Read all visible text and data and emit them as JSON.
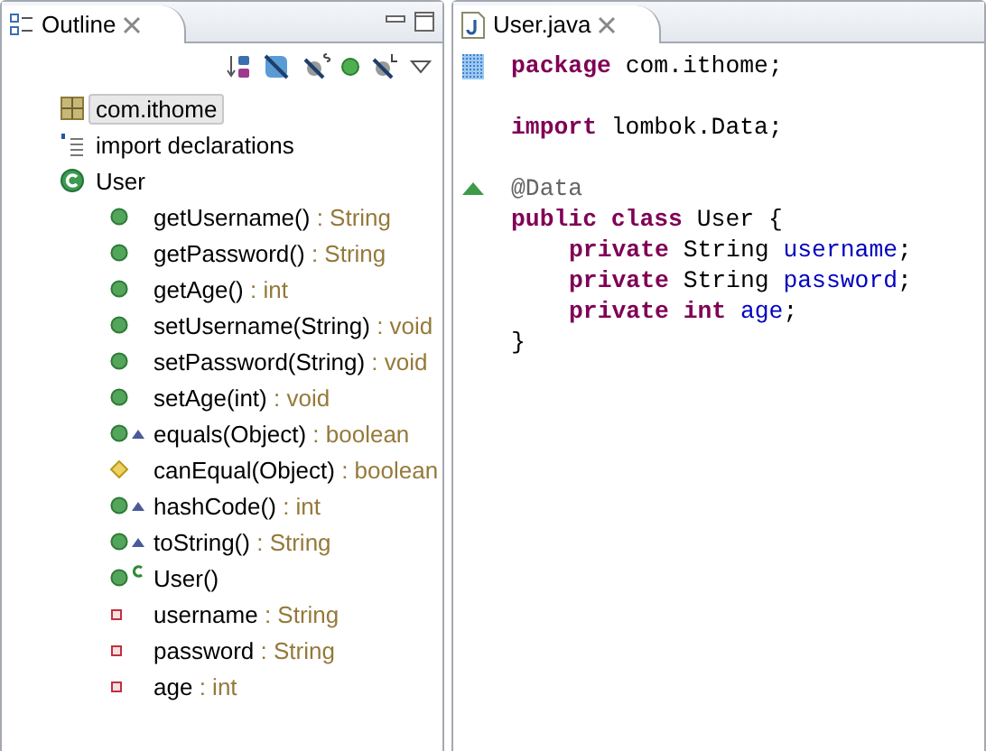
{
  "outline": {
    "title": "Outline",
    "toolbar": [
      {
        "kind": "sort"
      },
      {
        "kind": "hide-fields"
      },
      {
        "kind": "hide-static"
      },
      {
        "kind": "hide-non-public"
      },
      {
        "kind": "hide-local"
      },
      {
        "kind": "menu"
      }
    ],
    "tree": [
      {
        "name": "com.ithome",
        "kind": "package",
        "selected": true
      },
      {
        "name": "import declarations",
        "kind": "imports",
        "selected": false
      },
      {
        "name": "User",
        "kind": "class",
        "selected": false,
        "children": [
          {
            "name": "getUsername()",
            "type": ": String",
            "kind": "public"
          },
          {
            "name": "getPassword()",
            "type": ": String",
            "kind": "public"
          },
          {
            "name": "getAge()",
            "type": ": int",
            "kind": "public"
          },
          {
            "name": "setUsername(String)",
            "type": ": void",
            "kind": "public"
          },
          {
            "name": "setPassword(String)",
            "type": ": void",
            "kind": "public"
          },
          {
            "name": "setAge(int)",
            "type": ": void",
            "kind": "public"
          },
          {
            "name": "equals(Object)",
            "type": ": boolean",
            "kind": "public",
            "override": true
          },
          {
            "name": "canEqual(Object)",
            "type": ": boolean",
            "kind": "default"
          },
          {
            "name": "hashCode()",
            "type": ": int",
            "kind": "public",
            "override": true
          },
          {
            "name": "toString()",
            "type": ": String",
            "kind": "public",
            "override": true
          },
          {
            "name": "User()",
            "kind": "public",
            "constructor": true
          },
          {
            "name": "username",
            "type": ": String",
            "kind": "private"
          },
          {
            "name": "password",
            "type": ": String",
            "kind": "private"
          },
          {
            "name": "age",
            "type": ": int",
            "kind": "private"
          }
        ]
      }
    ]
  },
  "editor": {
    "title": "User.java",
    "lines": [
      {
        "highlighted": true,
        "tokens": [
          {
            "kind": "keyword",
            "text": "package"
          },
          {
            "kind": "plain",
            "text": " com.ithome;"
          }
        ]
      },
      {
        "blank_before": true,
        "tokens": [
          {
            "kind": "keyword",
            "text": "import"
          },
          {
            "kind": "plain",
            "text": " lombok.Data;"
          }
        ]
      },
      {
        "blank_before": true,
        "override_marker": true,
        "tokens": [
          {
            "kind": "annotation",
            "text": "@Data"
          }
        ]
      },
      {
        "tokens": [
          {
            "kind": "keyword",
            "text": "public"
          },
          {
            "kind": "keyword",
            "text": " class"
          },
          {
            "kind": "plain",
            "text": " User {"
          }
        ]
      },
      {
        "indented": true,
        "tokens": [
          {
            "kind": "keyword",
            "text": "private"
          },
          {
            "kind": "plain",
            "text": " String "
          },
          {
            "kind": "field",
            "text": "username"
          },
          {
            "kind": "plain",
            "text": ";"
          }
        ]
      },
      {
        "indented": true,
        "tokens": [
          {
            "kind": "keyword",
            "text": "private"
          },
          {
            "kind": "plain",
            "text": " String "
          },
          {
            "kind": "field",
            "text": "password"
          },
          {
            "kind": "plain",
            "text": ";"
          }
        ]
      },
      {
        "indented": true,
        "tokens": [
          {
            "kind": "keyword",
            "text": "private"
          },
          {
            "kind": "keyword",
            "text": " int "
          },
          {
            "kind": "field",
            "text": "age"
          },
          {
            "kind": "plain",
            "text": ";"
          }
        ]
      },
      {
        "tokens": [
          {
            "kind": "plain",
            "text": "}"
          }
        ]
      }
    ]
  }
}
